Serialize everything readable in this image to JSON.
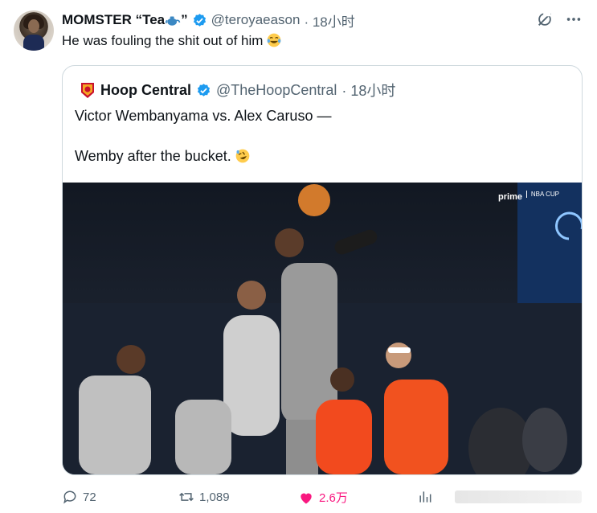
{
  "tweet": {
    "display_name": "MOMSTER “Tea",
    "display_name_suffix": "”",
    "handle": "@teroyaeason",
    "time": "· 18小时",
    "text": "He was fouling the shit out of him"
  },
  "quoted": {
    "display_name": "Hoop Central",
    "handle": "@TheHoopCentral",
    "time": "· 18小时",
    "line1": "Victor Wembanyama vs. Alex Caruso —",
    "line2": "Wemby after the bucket.",
    "video": {
      "broadcaster": "prime",
      "event_logo_text": "NBA CUP"
    }
  },
  "actions": {
    "reply_count": "72",
    "retweet_count": "1,089",
    "like_count": "2.6万"
  },
  "colors": {
    "verified": "#1d9bf0",
    "like": "#f91880",
    "muted": "#536471"
  }
}
